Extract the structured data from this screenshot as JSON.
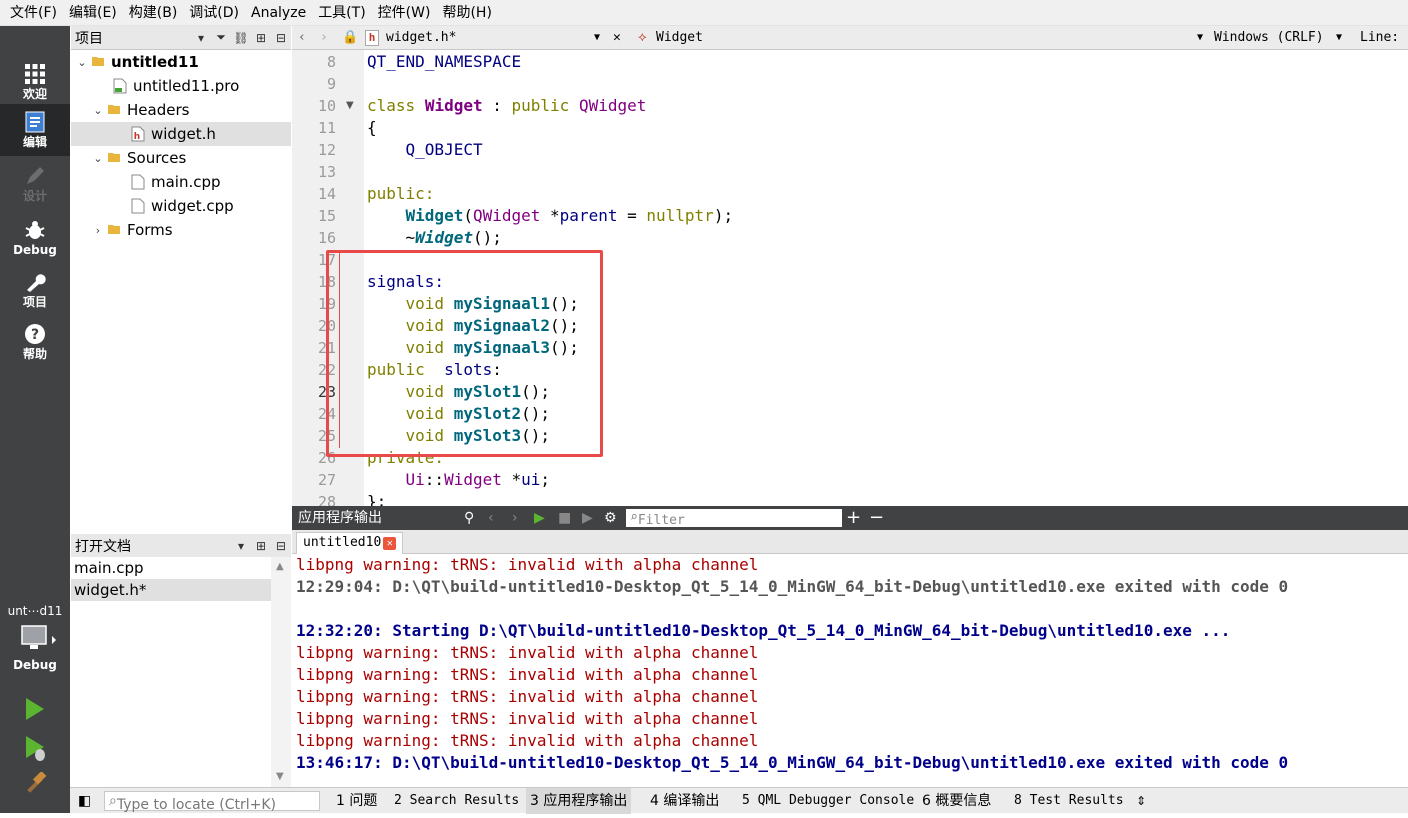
{
  "menubar": {
    "items": [
      "文件(F)",
      "编辑(E)",
      "构建(B)",
      "调试(D)",
      "Analyze",
      "工具(T)",
      "控件(W)",
      "帮助(H)"
    ]
  },
  "modes": {
    "welcome": "欢迎",
    "edit": "编辑",
    "design": "设计",
    "debug": "Debug",
    "project": "项目",
    "help": "帮助",
    "kit_name": "unt⋯d11",
    "kit_mode": "Debug"
  },
  "projects_panel": {
    "title": "项目",
    "tree": [
      "untitled11",
      "untitled11.pro",
      "Headers",
      "widget.h",
      "Sources",
      "main.cpp",
      "widget.cpp",
      "Forms"
    ]
  },
  "open_docs_panel": {
    "title": "打开文档",
    "items": [
      "main.cpp",
      "widget.h*"
    ]
  },
  "editor_toolbar": {
    "file": "widget.h*",
    "symbol": "Widget",
    "line_ending": "Windows (CRLF)",
    "line_label": "Line:"
  },
  "editor": {
    "line_numbers": [
      "8",
      "9",
      "10",
      "11",
      "12",
      "13",
      "14",
      "15",
      "16",
      "17",
      "18",
      "19",
      "20",
      "21",
      "22",
      "23",
      "24",
      "25",
      "26",
      "27",
      "28"
    ],
    "current_line": "23",
    "lines": [
      "QT_END_NAMESPACE",
      "",
      "class Widget : public QWidget",
      "{",
      "    Q_OBJECT",
      "",
      "public:",
      "    Widget(QWidget *parent = nullptr);",
      "    ~Widget();",
      "",
      "signals:",
      "    void mySignaal1();",
      "    void mySignaal2();",
      "    void mySignaal3();",
      "public  slots:",
      "    void mySlot1();",
      "    void mySlot2();",
      "    void mySlot3();",
      "private:",
      "    Ui::Widget *ui;",
      "};"
    ]
  },
  "output_pane": {
    "title": "应用程序输出",
    "filter_placeholder": "Filter",
    "tab": "untitled10",
    "lines": [
      {
        "t": "libpng warning: tRNS: invalid with alpha channel",
        "k": "warn"
      },
      {
        "t": "12:29:04: D:\\QT\\build-untitled10-Desktop_Qt_5_14_0_MinGW_64_bit-Debug\\untitled10.exe exited with code 0",
        "k": "exit"
      },
      {
        "t": "",
        "k": "warn"
      },
      {
        "t": "12:32:20: Starting D:\\QT\\build-untitled10-Desktop_Qt_5_14_0_MinGW_64_bit-Debug\\untitled10.exe ...",
        "k": "start"
      },
      {
        "t": "libpng warning: tRNS: invalid with alpha channel",
        "k": "warn"
      },
      {
        "t": "libpng warning: tRNS: invalid with alpha channel",
        "k": "warn"
      },
      {
        "t": "libpng warning: tRNS: invalid with alpha channel",
        "k": "warn"
      },
      {
        "t": "libpng warning: tRNS: invalid with alpha channel",
        "k": "warn"
      },
      {
        "t": "libpng warning: tRNS: invalid with alpha channel",
        "k": "warn"
      },
      {
        "t": "13:46:17: D:\\QT\\build-untitled10-Desktop_Qt_5_14_0_MinGW_64_bit-Debug\\untitled10.exe exited with code 0",
        "k": "start"
      }
    ]
  },
  "statusbar": {
    "locate_placeholder": "Type to locate (Ctrl+K)",
    "panes": [
      "1 问题",
      "2 Search Results",
      "3 应用程序输出",
      "4 编译输出",
      "5 QML Debugger Console",
      "6 概要信息",
      "8 Test Results"
    ]
  }
}
